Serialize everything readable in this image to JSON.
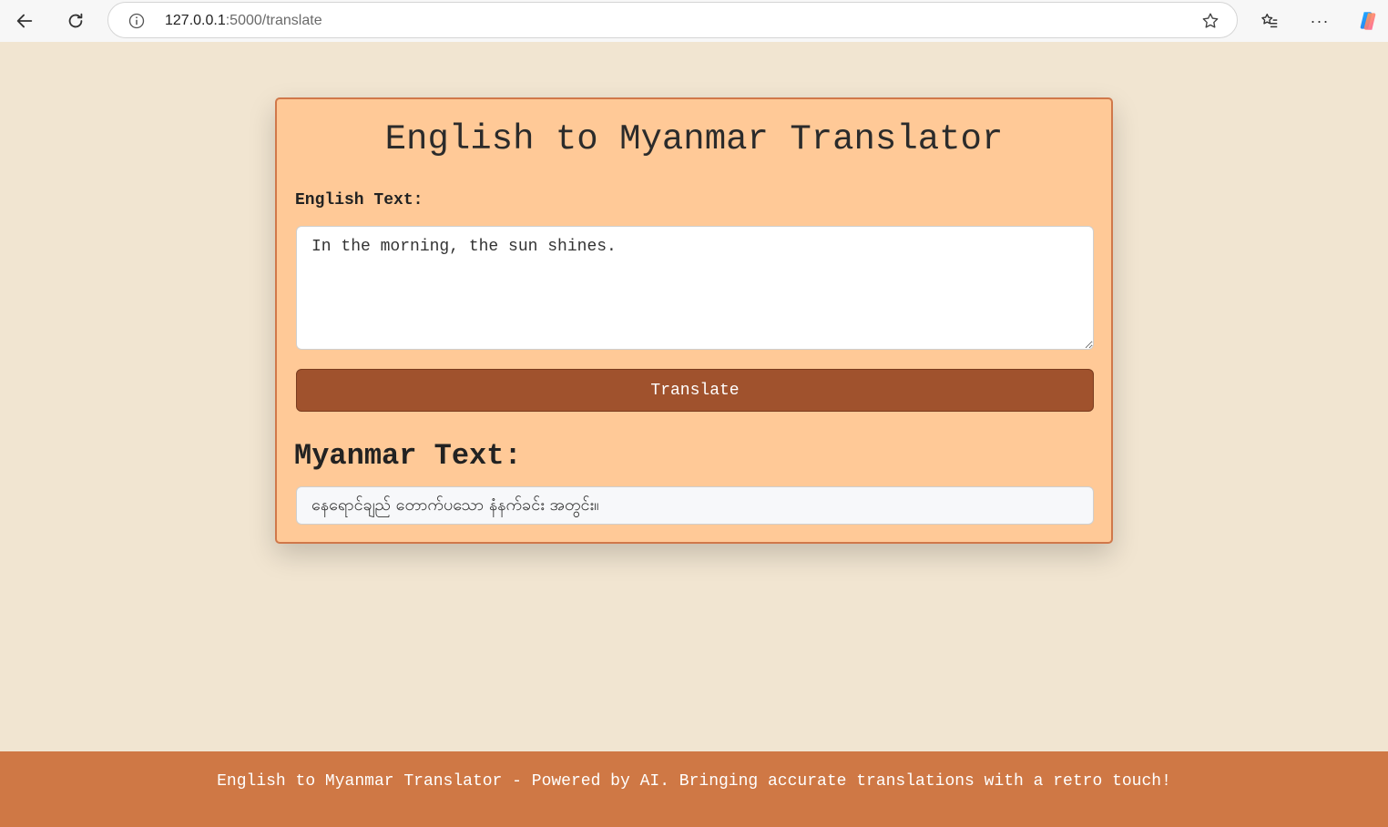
{
  "browser": {
    "url_host": "127.0.0.1",
    "url_path": ":5000/translate",
    "icons": [
      "back-arrow-icon",
      "reload-icon",
      "info-icon",
      "star-icon",
      "favorites-icon",
      "more-icon",
      "copilot-icon"
    ]
  },
  "translator": {
    "title": "English to Myanmar Translator",
    "english_label": "English Text:",
    "english_input_value": "In the morning, the sun shines.",
    "translate_button_label": "Translate",
    "myanmar_heading": "Myanmar Text:",
    "myanmar_output": "နေရောင်ချည် တောက်ပသော နံနက်ခင်း အတွင်း။"
  },
  "footer": {
    "text": "English to Myanmar Translator - Powered by AI. Bringing accurate translations with a retro touch!"
  },
  "colors": {
    "page_background": "#f1e5d1",
    "card_background": "#ffc997",
    "card_border": "#d0784a",
    "button_background": "#a0522d",
    "footer_background": "#cf7845"
  }
}
